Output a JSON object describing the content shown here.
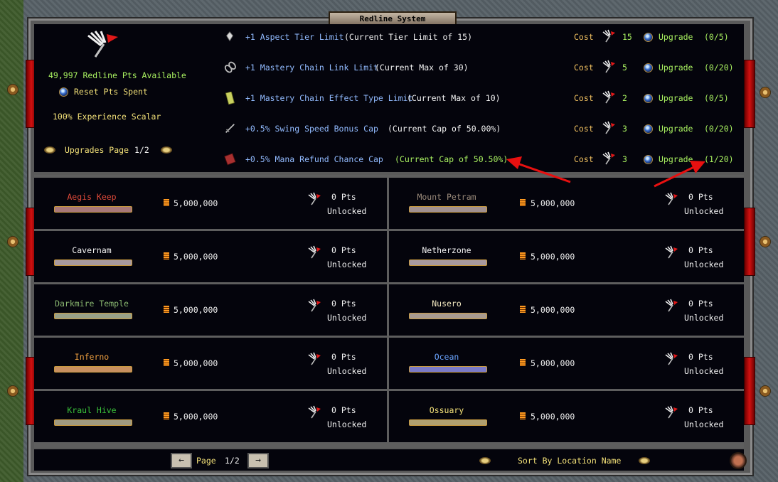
{
  "window": {
    "title": "Redline System"
  },
  "summary": {
    "points_available": "49,997 Redline Pts Available",
    "reset_label": "Reset Pts Spent",
    "experience": "100% Experience Scalar",
    "upgrades_page_label": "Upgrades Page",
    "upgrades_page_value": "1/2"
  },
  "upgrades": [
    {
      "label": "+1 Aspect Tier Limit",
      "current": "(Current Tier Limit of 15)",
      "cost_label": "Cost",
      "cost": "15",
      "action": "Upgrade",
      "progress": "(0/5)",
      "icon": "crystal-icon"
    },
    {
      "label": "+1 Mastery Chain Link Limit",
      "current": "(Current Max of 30)",
      "cost_label": "Cost",
      "cost": "5",
      "action": "Upgrade",
      "progress": "(0/20)",
      "icon": "chain-icon"
    },
    {
      "label": "+1 Mastery Chain Effect Type Limit",
      "current": "(Current Max of 10)",
      "cost_label": "Cost",
      "cost": "2",
      "action": "Upgrade",
      "progress": "(0/5)",
      "icon": "scroll-icon"
    },
    {
      "label": "+0.5% Swing Speed Bonus Cap",
      "current": "(Current Cap of 50.00%)",
      "cost_label": "Cost",
      "cost": "3",
      "action": "Upgrade",
      "progress": "(0/20)",
      "icon": "dagger-icon"
    },
    {
      "label": "+0.5% Mana Refund Chance Cap",
      "current": "(Current Cap of 50.50%)",
      "cost_label": "Cost",
      "cost": "3",
      "action": "Upgrade",
      "progress": "(1/20)",
      "icon": "book-icon"
    }
  ],
  "locations": [
    {
      "name": "Aegis Keep",
      "color": "#e04a3a",
      "bar": "#a87878",
      "gold": "5,000,000",
      "pts": "0 Pts",
      "status": "Unlocked"
    },
    {
      "name": "Mount Petram",
      "color": "#9a8a7a",
      "bar": "#a09090",
      "gold": "5,000,000",
      "pts": "0 Pts",
      "status": "Unlocked"
    },
    {
      "name": "Cavernam",
      "color": "#f2f2f2",
      "bar": "#a89aa0",
      "gold": "5,000,000",
      "pts": "0 Pts",
      "status": "Unlocked"
    },
    {
      "name": "Netherzone",
      "color": "#f2f2f2",
      "bar": "#a89aa0",
      "gold": "5,000,000",
      "pts": "0 Pts",
      "status": "Unlocked"
    },
    {
      "name": "Darkmire Temple",
      "color": "#8ab870",
      "bar": "#98a088",
      "gold": "5,000,000",
      "pts": "0 Pts",
      "status": "Unlocked"
    },
    {
      "name": "Nusero",
      "color": "#f2e8c0",
      "bar": "#a89a90",
      "gold": "5,000,000",
      "pts": "0 Pts",
      "status": "Unlocked"
    },
    {
      "name": "Inferno",
      "color": "#f0a040",
      "bar": "#c89060",
      "gold": "5,000,000",
      "pts": "0 Pts",
      "status": "Unlocked"
    },
    {
      "name": "Ocean",
      "color": "#6aa4ff",
      "bar": "#7a7ac8",
      "gold": "5,000,000",
      "pts": "0 Pts",
      "status": "Unlocked"
    },
    {
      "name": "Kraul Hive",
      "color": "#3ac03a",
      "bar": "#a09a80",
      "gold": "5,000,000",
      "pts": "0 Pts",
      "status": "Unlocked"
    },
    {
      "name": "Ossuary",
      "color": "#f2e078",
      "bar": "#b0a070",
      "gold": "5,000,000",
      "pts": "0 Pts",
      "status": "Unlocked"
    }
  ],
  "footer": {
    "page_label": "Page",
    "page_value": "1/2",
    "sort_label": "Sort By Location Name"
  }
}
